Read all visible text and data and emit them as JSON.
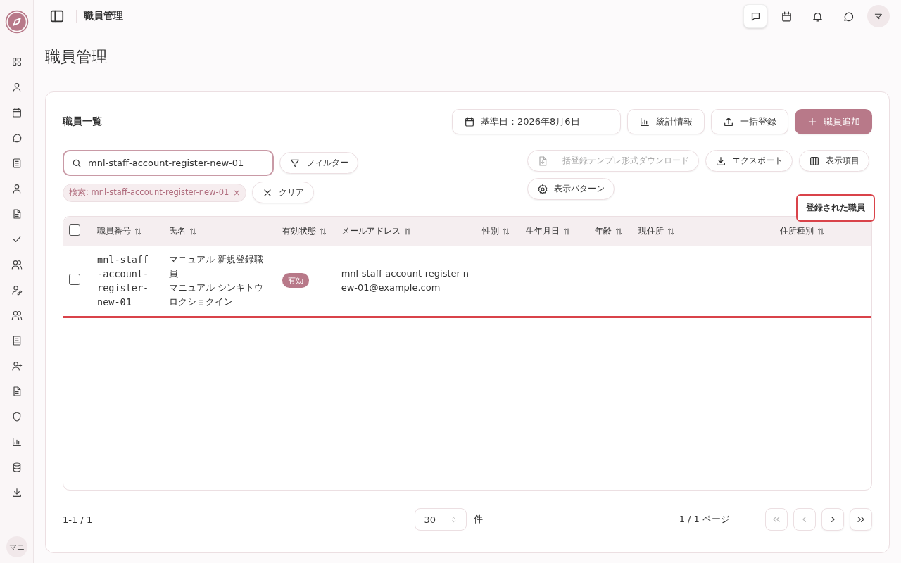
{
  "topbar": {
    "title": "職員管理",
    "avatar": "マ"
  },
  "sidebar": {
    "user": "マニ"
  },
  "page_title": "職員管理",
  "card": {
    "title": "職員一覧",
    "date_button": "基準日：2026年8月6日",
    "actions": [
      {
        "label": "統計情報",
        "kind": "stats"
      },
      {
        "label": "一括登録",
        "kind": "upload"
      },
      {
        "label": "職員追加",
        "kind": "add"
      }
    ],
    "search": {
      "value": "mnl-staff-account-register-new-01"
    },
    "filter_button": "フィルター",
    "chip": {
      "label": "検索: mnl-staff-account-register-new-01",
      "remove": "×"
    },
    "clear_button": "クリア",
    "tools": [
      {
        "label": "一括登録テンプレ形式ダウンロード",
        "kind": "template",
        "disabled": true
      },
      {
        "label": "エクスポート",
        "kind": "export",
        "disabled": false
      },
      {
        "label": "表示項目",
        "kind": "columns",
        "disabled": false
      },
      {
        "label": "表示パターン",
        "kind": "pattern",
        "disabled": false
      }
    ],
    "table": {
      "select_all": {
        "checked": false
      },
      "columns": [
        "職員番号",
        "氏名",
        "有効状態",
        "メールアドレス",
        "性別",
        "生年月日",
        "年齢",
        "現住所",
        "住所種別"
      ],
      "rows": [
        {
          "checked": false,
          "cells": [
            {
              "kind": "mono",
              "text": "mnl-staff-account-register-new-01"
            },
            {
              "kind": "name",
              "text": "マニュアル 新規登録職員",
              "sub": "マニュアル シンキトウロクショクイン"
            },
            {
              "kind": "badge",
              "text": "有効"
            },
            {
              "kind": "text",
              "text": "mnl-staff-account-register-new-01@example.com"
            },
            {
              "kind": "text",
              "text": "-"
            },
            {
              "kind": "text",
              "text": "-"
            },
            {
              "kind": "text",
              "text": "-"
            },
            {
              "kind": "text",
              "text": "-"
            },
            {
              "kind": "text",
              "text": "-"
            },
            {
              "kind": "text",
              "text": "-"
            }
          ]
        }
      ]
    },
    "tooltip": "登録された職員",
    "pagination": {
      "range": "1-1 / 1",
      "page_size": "30",
      "unit": "件",
      "page": "1 / 1 ページ",
      "buttons": [
        {
          "kind": "first",
          "disabled": true
        },
        {
          "kind": "prev",
          "disabled": true
        },
        {
          "kind": "next",
          "disabled": false
        },
        {
          "kind": "last",
          "disabled": false
        }
      ]
    }
  }
}
